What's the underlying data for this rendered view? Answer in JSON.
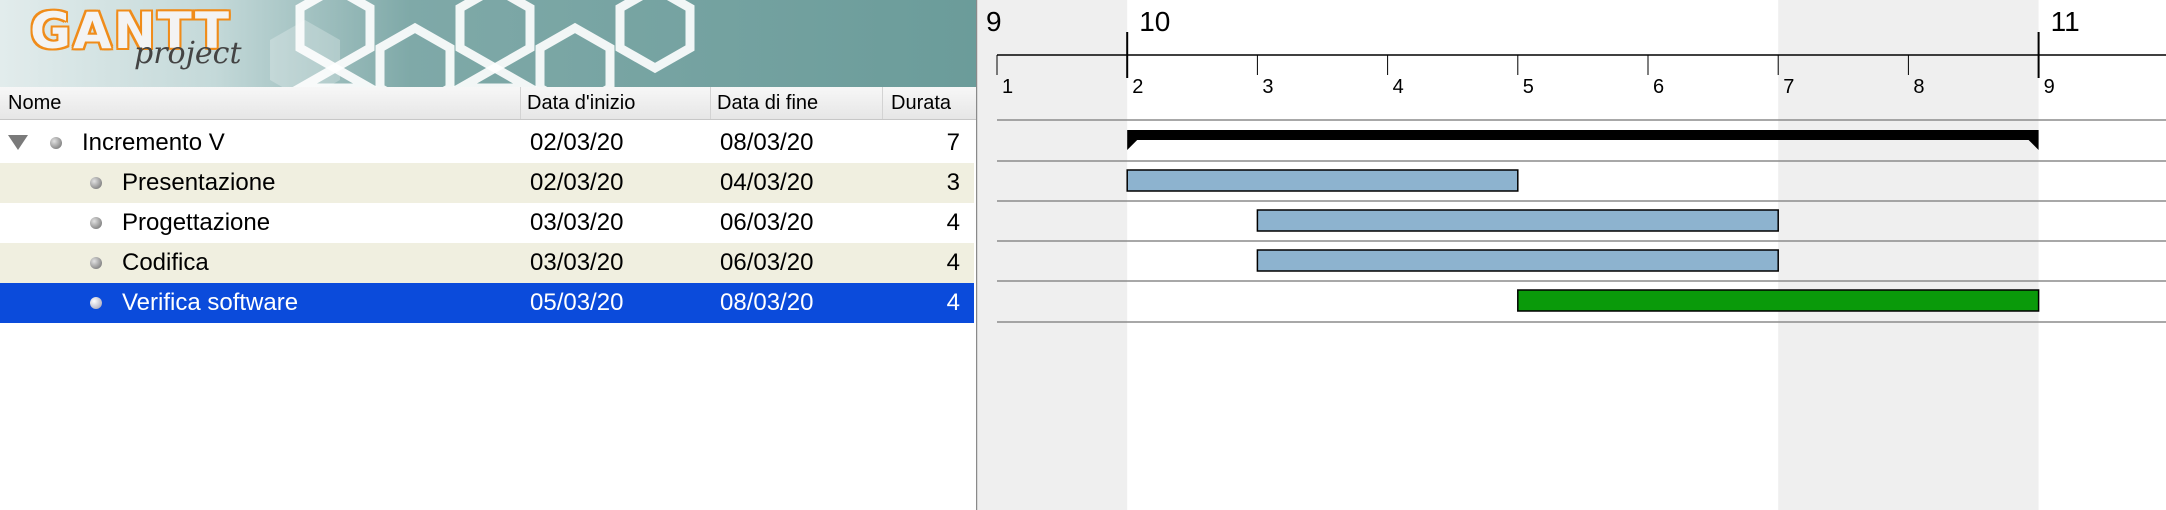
{
  "app": {
    "logo_word": "GANTT",
    "logo_sub": "project"
  },
  "table": {
    "columns": [
      "Nome",
      "Data d'inizio",
      "Data di fine",
      "Durata"
    ],
    "rows": [
      {
        "name": "Incremento V",
        "start": "02/03/20",
        "end": "08/03/20",
        "duration": "7",
        "level": 0,
        "expanded": true,
        "selected": false
      },
      {
        "name": "Presentazione",
        "start": "02/03/20",
        "end": "04/03/20",
        "duration": "3",
        "level": 1,
        "selected": false
      },
      {
        "name": "Progettazione",
        "start": "03/03/20",
        "end": "06/03/20",
        "duration": "4",
        "level": 1,
        "selected": false
      },
      {
        "name": "Codifica",
        "start": "03/03/20",
        "end": "06/03/20",
        "duration": "4",
        "level": 1,
        "selected": false
      },
      {
        "name": "Verifica software",
        "start": "05/03/20",
        "end": "08/03/20",
        "duration": "4",
        "level": 1,
        "selected": true
      }
    ]
  },
  "timeline": {
    "weeks": [
      "9",
      "10",
      "11"
    ],
    "days": [
      "1",
      "2",
      "3",
      "4",
      "5",
      "6",
      "7",
      "8",
      "9"
    ],
    "weekend_shading": "#efefef",
    "task_color": "#8db3cf",
    "selected_task_color": "#0a9a0a",
    "summary_color": "#000000"
  }
}
